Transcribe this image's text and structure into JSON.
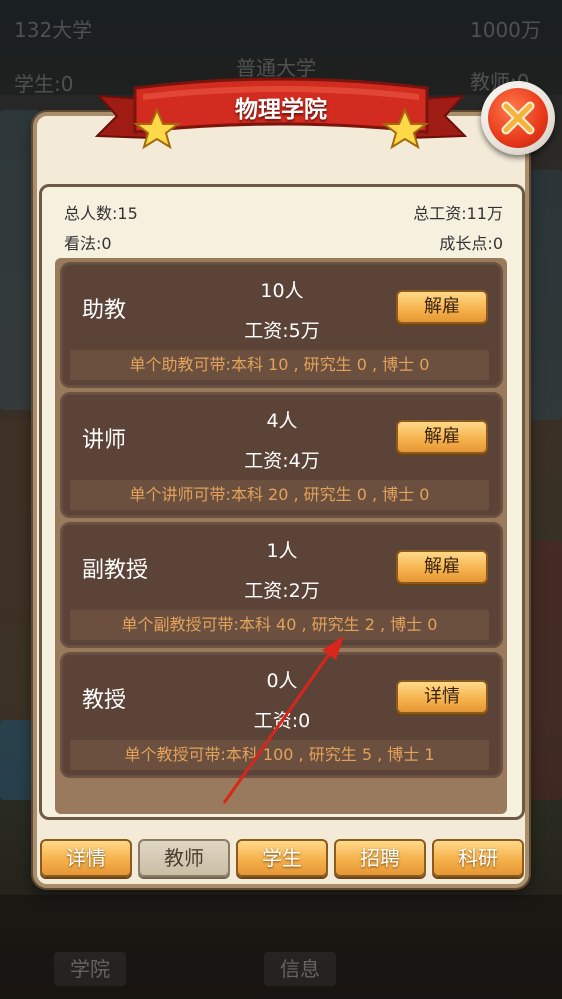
{
  "background": {
    "university_count": "132大学",
    "money": "1000万",
    "university_type": "普通大学",
    "students": "学生:0",
    "teachers": "教师:0",
    "bottom_tabs": [
      "学院",
      "信息"
    ]
  },
  "panel": {
    "title": "物理学院",
    "stats": {
      "total_people": "总人数:15",
      "total_salary": "总工资:11万",
      "opinion": "看法:0",
      "growth_points": "成长点:0"
    },
    "positions": [
      {
        "title": "助教",
        "count": "10人",
        "salary": "工资:5万",
        "button": "解雇",
        "capacity": "单个助教可带:本科 10 , 研究生 0 , 博士 0"
      },
      {
        "title": "讲师",
        "count": "4人",
        "salary": "工资:4万",
        "button": "解雇",
        "capacity": "单个讲师可带:本科 20 , 研究生 0 , 博士 0"
      },
      {
        "title": "副教授",
        "count": "1人",
        "salary": "工资:2万",
        "button": "解雇",
        "capacity": "单个副教授可带:本科 40 , 研究生 2 , 博士 0"
      },
      {
        "title": "教授",
        "count": "0人",
        "salary": "工资:0",
        "button": "详情",
        "capacity": "单个教授可带:本科 100 , 研究生 5 , 博士 1"
      }
    ],
    "tabs": [
      {
        "label": "详情",
        "active": false
      },
      {
        "label": "教师",
        "active": true
      },
      {
        "label": "学生",
        "active": false
      },
      {
        "label": "招聘",
        "active": false
      },
      {
        "label": "科研",
        "active": false
      }
    ]
  },
  "colors": {
    "ribbon": "#c8281d",
    "button": "#f5b14a",
    "card": "#5b4337",
    "capacity_text": "#e3a25a",
    "arrow": "#d9261c"
  },
  "icons": {
    "close": "close-icon",
    "star": "star-icon"
  }
}
